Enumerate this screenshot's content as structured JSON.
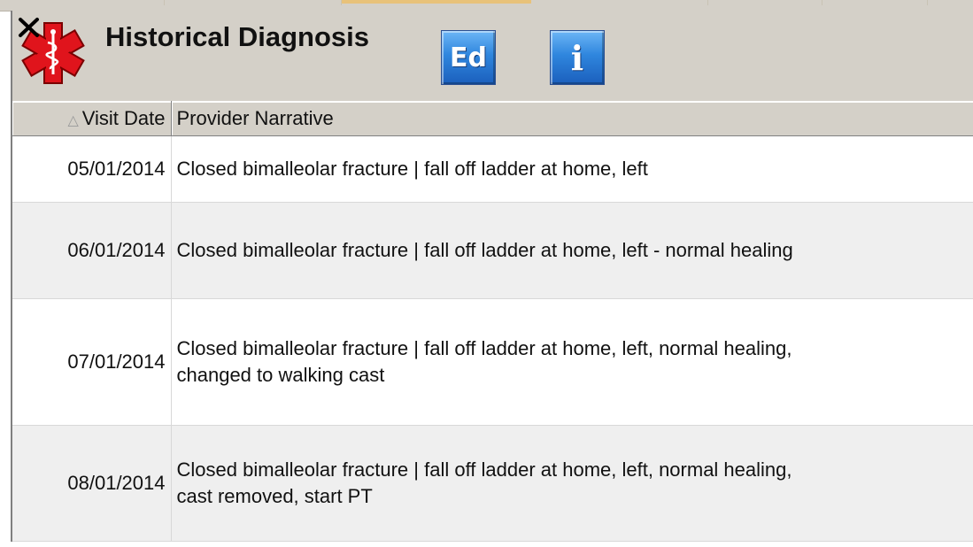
{
  "header": {
    "title": "Historical Diagnosis",
    "ed_label": "Ed",
    "info_label": "i"
  },
  "icons": {
    "medical": "star-of-life-icon",
    "edit": "edit-button-icon",
    "info": "info-icon"
  },
  "colors": {
    "medical_red": "#e0141c",
    "button_blue": "#2f86de",
    "panel_gray": "#d4d0c8",
    "alt_row": "#efefef"
  },
  "table": {
    "columns": [
      "Visit Date",
      "Provider Narrative"
    ],
    "sort_indicator": "△",
    "rows": [
      {
        "date": "05/01/2014",
        "lines": [
          "Closed bimalleolar fracture | fall off ladder at home, left"
        ]
      },
      {
        "date": "06/01/2014",
        "lines": [
          "Closed bimalleolar fracture | fall off ladder at home, left - normal healing"
        ]
      },
      {
        "date": "07/01/2014",
        "lines": [
          "Closed bimalleolar fracture | fall off ladder at home, left, normal healing,",
          "changed to walking cast"
        ]
      },
      {
        "date": "08/01/2014",
        "lines": [
          "Closed bimalleolar fracture | fall off ladder at home, left, normal healing,",
          "cast removed, start PT"
        ]
      }
    ]
  }
}
